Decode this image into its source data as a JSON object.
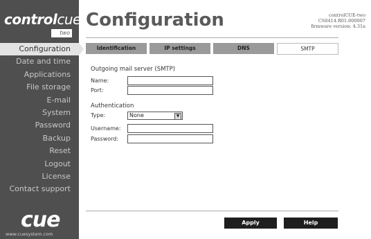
{
  "logo": {
    "control": "control",
    "cue": "cue",
    "two": "two"
  },
  "sidebar": {
    "items": [
      {
        "label": "Configuration"
      },
      {
        "label": "Date and time"
      },
      {
        "label": "Applications"
      },
      {
        "label": "File storage"
      },
      {
        "label": "E-mail"
      },
      {
        "label": "System"
      },
      {
        "label": "Password"
      },
      {
        "label": "Backup"
      },
      {
        "label": "Reset"
      },
      {
        "label": "Logout"
      },
      {
        "label": "License"
      },
      {
        "label": "Contact support"
      }
    ],
    "active_index": 0,
    "brand": "cue",
    "url": "www.cuesystem.com"
  },
  "header": {
    "title": "Configuration",
    "device_name": "controlCUE-two",
    "serial": "CS0414.R01.000007",
    "firmware": "firmware version: 4.31a"
  },
  "tabs": [
    {
      "label": "Identification"
    },
    {
      "label": "IP settings"
    },
    {
      "label": "DNS"
    },
    {
      "label": "SMTP"
    }
  ],
  "form": {
    "smtp_title": "Outgoing mail server (SMTP)",
    "name_label": "Name:",
    "name_value": "",
    "port_label": "Port:",
    "port_value": "",
    "auth_title": "Authentication",
    "type_label": "Type:",
    "type_value": "None",
    "username_label": "Username:",
    "username_value": "",
    "password_label": "Password:",
    "password_value": ""
  },
  "buttons": {
    "apply": "Apply",
    "help": "Help"
  }
}
